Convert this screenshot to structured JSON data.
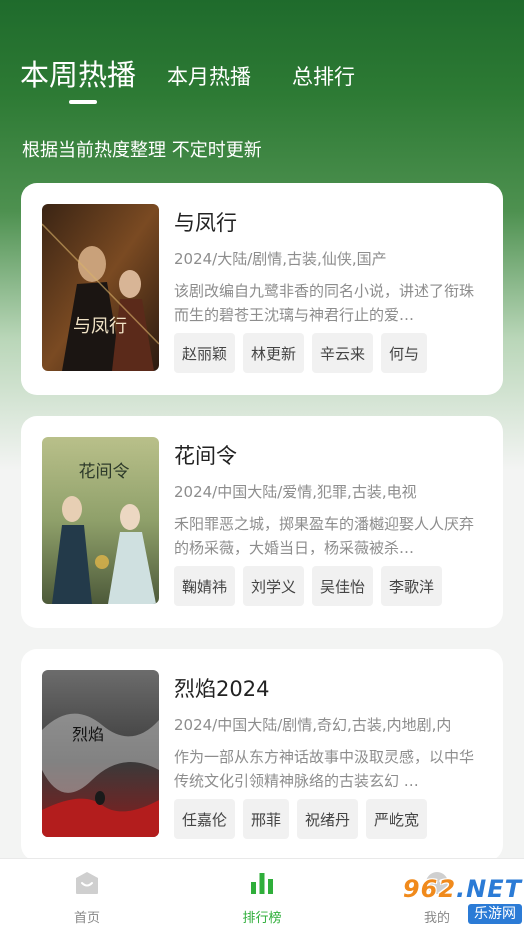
{
  "header": {
    "tabs": [
      {
        "label": "本周热播",
        "active": true
      },
      {
        "label": "本月热播",
        "active": false
      },
      {
        "label": "总排行",
        "active": false
      }
    ],
    "subtitle": "根据当前热度整理 不定时更新"
  },
  "shows": [
    {
      "title": "与凤行",
      "meta": "2024/大陆/剧情,古装,仙侠,国产",
      "description": "该剧改编自九鹭非香的同名小说，讲述了衔珠而生的碧苍王沈璃与神君行止的爱…",
      "actors": [
        "赵丽颖",
        "林更新",
        "辛云来",
        "何与"
      ],
      "poster_text": "与凤行"
    },
    {
      "title": "花间令",
      "meta": "2024/中国大陆/爱情,犯罪,古装,电视",
      "description": "禾阳罪恶之城，掷果盈车的潘樾迎娶人人厌弃的杨采薇，大婚当日，杨采薇被杀…",
      "actors": [
        "鞠婧祎",
        "刘学义",
        "吴佳怡",
        "李歌洋"
      ],
      "poster_text": "花间令"
    },
    {
      "title": "烈焰2024",
      "meta": "2024/中国大陆/剧情,奇幻,古装,内地剧,内",
      "description": "作为一部从东方神话故事中汲取灵感，以中华传统文化引领精神脉络的古装玄幻 …",
      "actors": [
        "任嘉伦",
        "邢菲",
        "祝绪丹",
        "严屹宽"
      ],
      "poster_text": "烈焰"
    }
  ],
  "bottom_nav": [
    {
      "label": "首页",
      "icon": "home-icon"
    },
    {
      "label": "排行榜",
      "icon": "ranking-icon",
      "active": true
    },
    {
      "label": "我的",
      "icon": "profile-icon"
    }
  ],
  "watermark": {
    "top": "962",
    "net": ".NET",
    "bottom": "乐游网"
  },
  "colors": {
    "accent": "#2fae3a",
    "header_green": "#1f6b2c"
  }
}
